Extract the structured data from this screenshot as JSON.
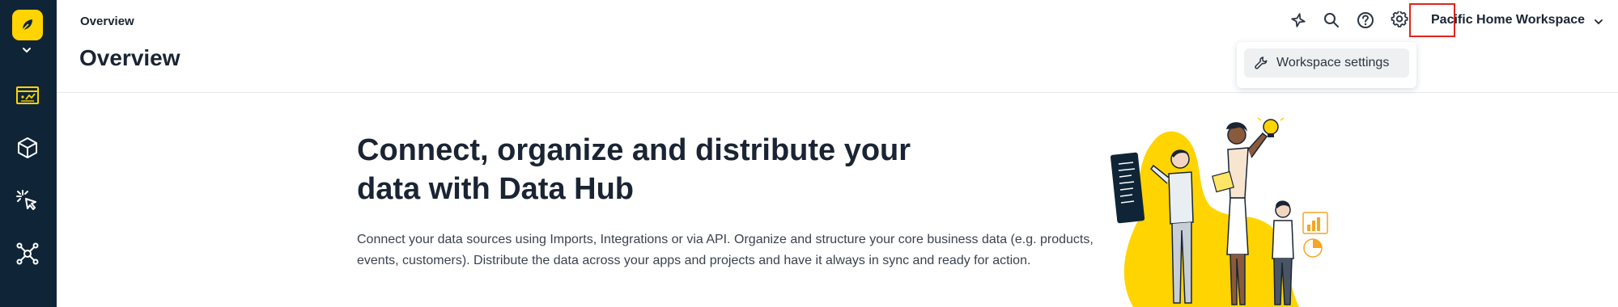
{
  "app": {
    "breadcrumb": "Overview",
    "page_title": "Overview",
    "workspace_name": "Pacific Home Workspace"
  },
  "sidebar": {
    "items": [
      {
        "icon": "dashboard-icon"
      },
      {
        "icon": "cube-icon"
      },
      {
        "icon": "click-icon"
      },
      {
        "icon": "network-hub-icon"
      }
    ]
  },
  "toolbar": {
    "icons": [
      "ai-sparkle-icon",
      "search-icon",
      "help-icon",
      "gear-icon"
    ]
  },
  "settings_menu": {
    "items": [
      {
        "label": "Workspace settings",
        "icon": "wrench-icon"
      }
    ]
  },
  "hero": {
    "title": "Connect, organize and distribute your data with Data Hub",
    "description": "Connect your data sources using Imports, Integrations or via API. Organize and structure your core business data (e.g. products, events, customers). Distribute the data across your apps and projects and have it always in sync and ready for action."
  },
  "colors": {
    "sidebar_bg": "#0f2537",
    "brand_yellow": "#ffd400",
    "highlight_red": "#e1241b"
  }
}
